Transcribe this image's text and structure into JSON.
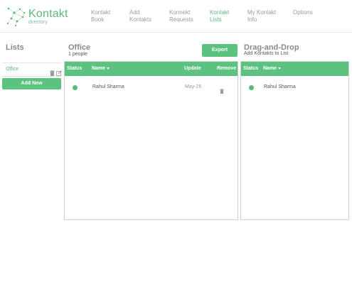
{
  "brand": {
    "name": "Kontakt",
    "tagline": "directory",
    "color": "#5cb87a"
  },
  "nav": [
    {
      "label": "Kontakt\nBook"
    },
    {
      "label": "Add\nKontakts"
    },
    {
      "label": "Konnekt\nRequests"
    },
    {
      "label": "Kontakt\nLists",
      "active": true
    },
    {
      "label": "My Kontakt\nInfo"
    },
    {
      "label": "Options"
    }
  ],
  "sidebar": {
    "title": "Lists",
    "items": [
      {
        "label": "Office"
      }
    ],
    "add_new_label": "Add New"
  },
  "office": {
    "title": "Office",
    "count": "1 people",
    "export_label": "Export",
    "columns": {
      "status": "Status",
      "name": "Name",
      "update": "Update",
      "remove": "Remove"
    },
    "rows": [
      {
        "name": "Rahul Sharma",
        "update": "May-26",
        "status": "online"
      }
    ]
  },
  "dnd": {
    "title": "Drag-and-Drop",
    "subtitle": "Add Kontakts to List",
    "columns": {
      "status": "Status",
      "name": "Name"
    },
    "rows": [
      {
        "name": "Rahul Sharma",
        "status": "online"
      }
    ]
  },
  "colors": {
    "accent": "#5cc27f",
    "text": "#555555"
  }
}
